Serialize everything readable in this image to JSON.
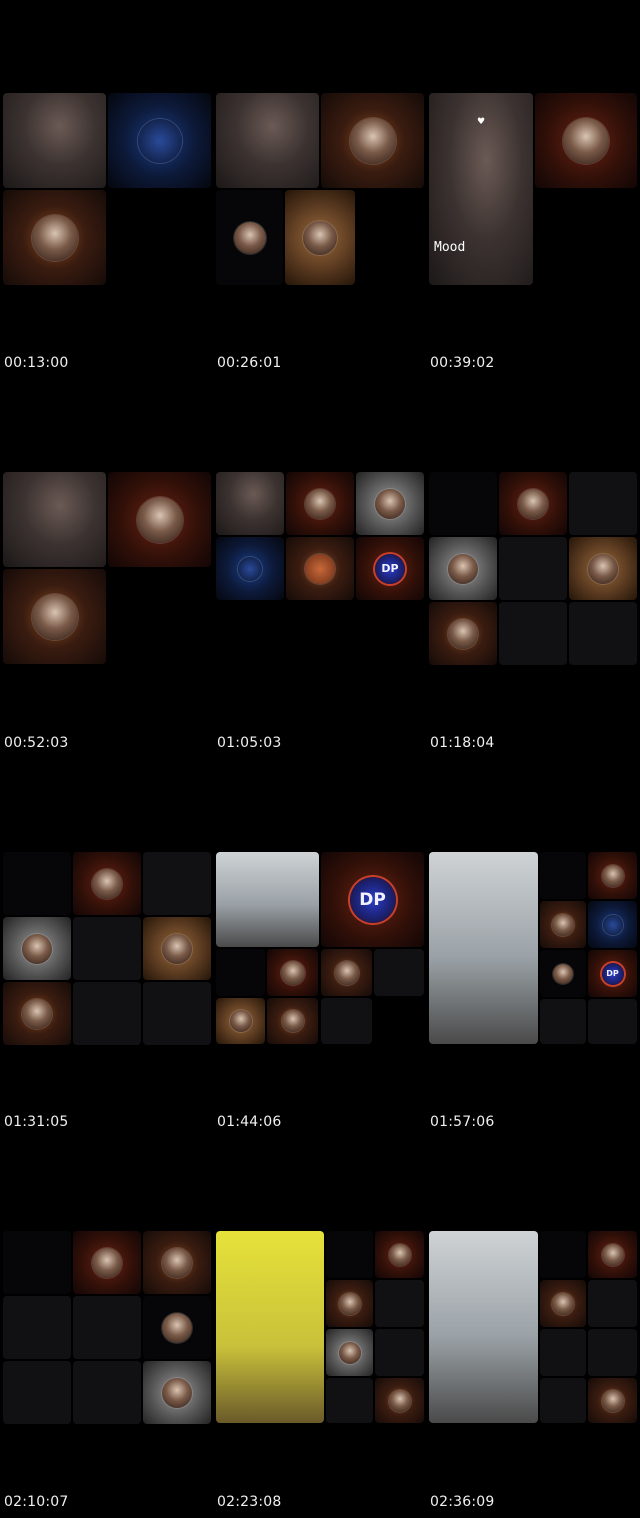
{
  "timestamps": [
    "00:13:00",
    "00:26:01",
    "00:39:02",
    "00:52:03",
    "01:05:03",
    "01:18:04",
    "01:31:05",
    "01:44:06",
    "01:57:06",
    "02:10:07",
    "02:23:08",
    "02:36:09"
  ],
  "cell3": {
    "overlay_text": "Mood"
  },
  "badges": {
    "dp": "DP"
  }
}
